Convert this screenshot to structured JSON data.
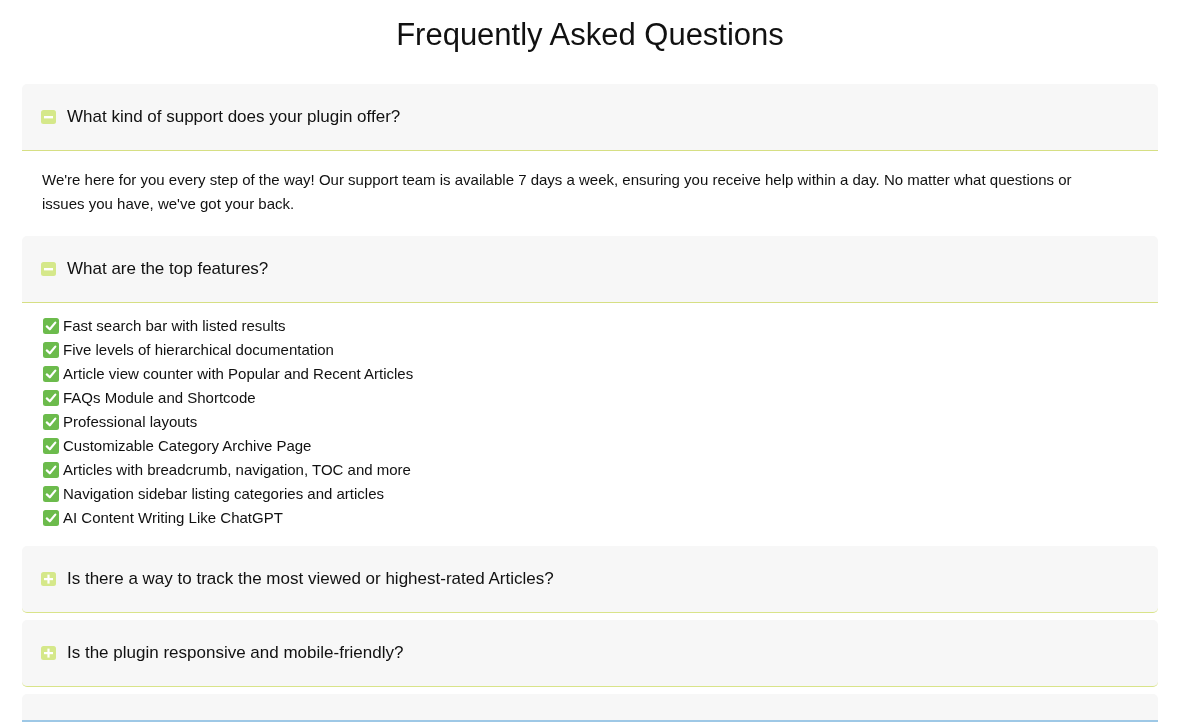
{
  "title": "Frequently Asked Questions",
  "faqs": [
    {
      "question": "What kind of support does your plugin offer?",
      "expanded": true,
      "answer": {
        "kind": "paragraph",
        "text": "We're here for you every step of the way! Our support team is available 7 days a week, ensuring you receive help within a day. No matter what questions or issues you have, we've got your back."
      }
    },
    {
      "question": "What are the top features?",
      "expanded": true,
      "answer": {
        "kind": "checklist",
        "items": [
          "Fast search bar with listed results",
          "Five levels of hierarchical documentation",
          "Article view counter with Popular and Recent Articles",
          "FAQs Module and Shortcode",
          "Professional layouts",
          "Customizable Category Archive Page",
          "Articles with breadcrumb, navigation, TOC and more",
          "Navigation sidebar listing categories and articles",
          "AI Content Writing Like ChatGPT"
        ]
      }
    },
    {
      "question": "Is there a way to track the most viewed or highest-rated Articles?",
      "expanded": false
    },
    {
      "question": "Is the plugin responsive and mobile-friendly?",
      "expanded": false
    },
    {
      "focused": true
    }
  ]
}
